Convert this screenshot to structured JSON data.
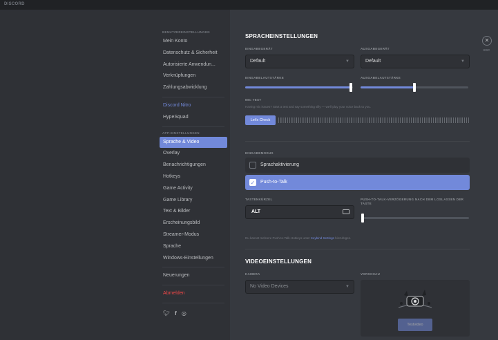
{
  "titlebar": {
    "app_name": "DISCORD"
  },
  "sidebar": {
    "user_settings_header": "BENUTZEREINSTELLUNGEN",
    "user_items": [
      "Mein Konto",
      "Datenschutz & Sicherheit",
      "Autorisierte Anwendun...",
      "Verknüpfungen",
      "Zahlungsabwicklung"
    ],
    "nitro_item": "Discord Nitro",
    "hypesquad_item": "HypeSquad",
    "app_settings_header": "APP-EINSTELLUNGEN",
    "app_items": [
      "Sprache & Video",
      "Overlay",
      "Benachrichtigungen",
      "Hotkeys",
      "Game Activity",
      "Game Library",
      "Text & Bilder",
      "Erscheinungsbild",
      "Streamer-Modus",
      "Sprache",
      "Windows-Einstellungen"
    ],
    "active_item": "Sprache & Video",
    "changelog_item": "Neuerungen",
    "logout_item": "Abmelden",
    "social_icons": [
      "twitter-icon",
      "facebook-icon",
      "instagram-icon"
    ]
  },
  "voice": {
    "title": "SPRACHEINSTELLUNGEN",
    "input_device_label": "EINGABEGERÄT",
    "input_device_value": "Default",
    "output_device_label": "AUSGABEGERÄT",
    "output_device_value": "Default",
    "input_volume_label": "EINGABELAUTSTÄRKE",
    "input_volume_pct": 0.98,
    "output_volume_label": "AUSGABELAUTSTÄRKE",
    "output_volume_pct": 0.5,
    "mic_test_label": "MIC TEST",
    "mic_test_hint": "Having mic issues? Start a test and say something silly — we'll play your voice back to you.",
    "lets_check_button": "Let's Check",
    "input_mode_label": "EINGABEMODUS",
    "mode_voice_activity": "Sprachaktivierung",
    "mode_push_to_talk": "Push-to-Talk",
    "selected_mode": "Push-to-Talk",
    "shortcut_label": "TASTENKÜRZEL",
    "shortcut_value": "ALT",
    "ptt_delay_label": "PUSH-TO-TALK-VERZÖGERUNG NACH DEM LOSLASSEN DER TASTE",
    "ptt_delay_pct": 0.0,
    "keybind_hint_before": "Du kannst mehrere Push-to-Talk-Hotkeys unter ",
    "keybind_hint_link": "Keybind Settings",
    "keybind_hint_after": " hinzufügen."
  },
  "video": {
    "title": "VIDEOEINSTELLUNGEN",
    "camera_label": "KAMERA",
    "camera_value": "No Video Devices",
    "preview_label": "VORSCHAU",
    "test_button": "Testvideo"
  },
  "close": {
    "label": "ESC"
  },
  "colors": {
    "accent": "#7289da",
    "danger": "#f04747",
    "bg_content": "#36393f",
    "bg_sidebar": "#2f3136"
  }
}
